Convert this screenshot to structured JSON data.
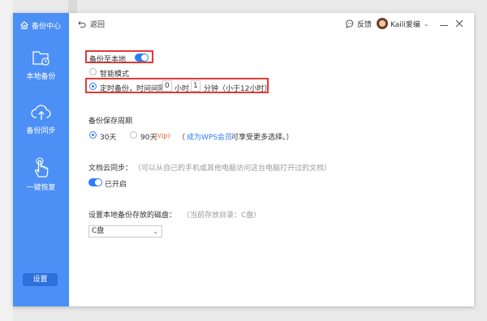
{
  "sidebar": {
    "title": "备份中心",
    "items": [
      {
        "label": "本地备份",
        "icon": "folder-clock-icon"
      },
      {
        "label": "备份同步",
        "icon": "cloud-upload-icon"
      },
      {
        "label": "一键恢复",
        "icon": "hand-pointer-icon"
      }
    ],
    "settings_label": "设置"
  },
  "topbar": {
    "back_label": "返回",
    "feedback_label": "反馈",
    "user_name": "Kaili爱编"
  },
  "local_backup": {
    "label": "备份至本地",
    "enabled": true,
    "smart_mode_label": "智能模式",
    "timed_label": "定时备份，时间间隔",
    "hours_value": "0",
    "hours_unit": "小时",
    "minutes_value": "1",
    "minutes_unit": "分钟（小于12小时）"
  },
  "retention": {
    "title": "备份保存周期",
    "option_30": "30天",
    "option_90": "90天",
    "vip_tag": "(vip)",
    "paren_open": "（",
    "member_link": "成为WPS会员",
    "more_text": "可享受更多选择。）"
  },
  "cloud_sync": {
    "title": "文档云同步：",
    "hint": "（可以从自己的手机或其他电脑访问这台电脑打开过的文档）",
    "status": "已开启"
  },
  "disk": {
    "title": "设置本地备份存放的磁盘：",
    "hint": "（当前存放目录：C盘）",
    "selected": "C盘"
  },
  "colors": {
    "sidebar": "#4c8ff5",
    "accent": "#2e7cf6",
    "highlight": "#e53935"
  }
}
